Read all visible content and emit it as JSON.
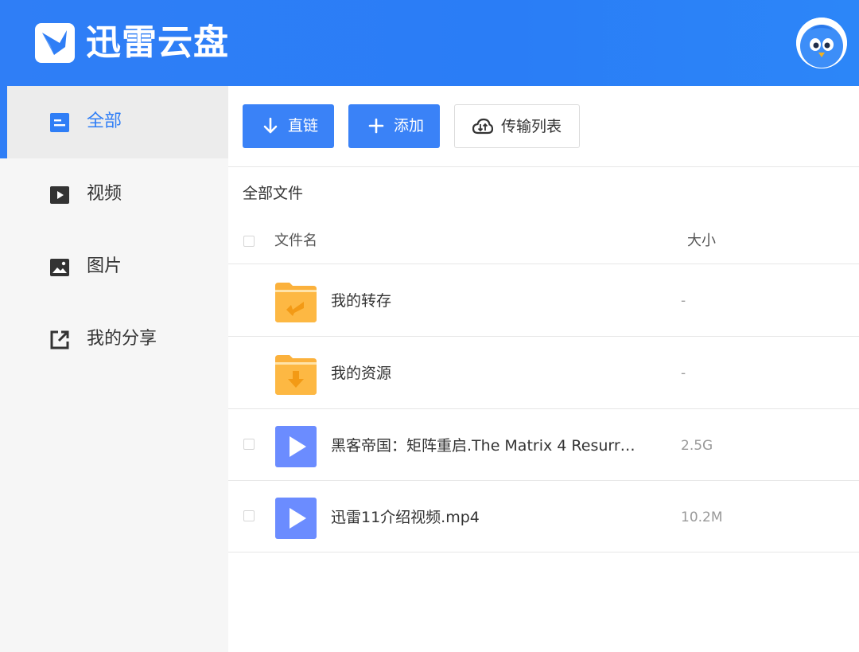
{
  "header": {
    "brand": "迅雷云盘",
    "colors": {
      "header_blue": "#2f7ef6",
      "accent": "#3a82f7"
    }
  },
  "sidebar": {
    "items": [
      {
        "label": "全部",
        "icon": "file-list-icon",
        "active": true
      },
      {
        "label": "视频",
        "icon": "video-icon",
        "active": false
      },
      {
        "label": "图片",
        "icon": "image-icon",
        "active": false
      },
      {
        "label": "我的分享",
        "icon": "share-icon",
        "active": false
      }
    ]
  },
  "toolbar": {
    "direct_link_label": "直链",
    "add_label": "添加",
    "transfer_list_label": "传输列表"
  },
  "main": {
    "breadcrumb": "全部文件",
    "columns": {
      "name": "文件名",
      "size": "大小"
    },
    "files": [
      {
        "name": "我的转存",
        "size": "-",
        "icon": "folder-transfer-icon"
      },
      {
        "name": "我的资源",
        "size": "-",
        "icon": "folder-download-icon"
      },
      {
        "name": "黑客帝国：矩阵重启.The Matrix 4 Resurr…",
        "size": "2.5G",
        "icon": "video-file-icon"
      },
      {
        "name": "迅雷11介绍视频.mp4",
        "size": "10.2M",
        "icon": "video-file-icon"
      }
    ]
  }
}
